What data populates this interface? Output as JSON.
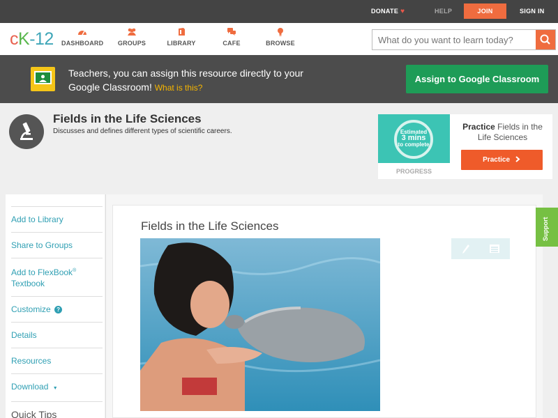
{
  "topbar": {
    "donate": "DONATE",
    "help": "HELP",
    "join": "JOIN",
    "signin": "SIGN IN"
  },
  "brand": {
    "c": "c",
    "k": "K",
    "n": "-12"
  },
  "nav": {
    "dashboard": "DASHBOARD",
    "groups": "GROUPS",
    "library": "LIBRARY",
    "cafe": "CAFE",
    "browse": "BROWSE"
  },
  "search": {
    "placeholder": "What do you want to learn today?"
  },
  "banner": {
    "text": "Teachers, you can assign this resource directly to your Google Classroom!",
    "link": "What is this?",
    "button": "Assign to Google Classroom"
  },
  "concept": {
    "title": "Fields in the Life Sciences",
    "description": "Discusses and defines different types of scientific careers."
  },
  "practice": {
    "estimated": "Estimated",
    "mins": "3 mins",
    "complete": "to complete",
    "progress_label": "PROGRESS",
    "title_bold": "Practice",
    "title_rest": "Fields in the Life Sciences",
    "button": "Practice"
  },
  "sidebar": {
    "items": [
      {
        "label": "Add to Library"
      },
      {
        "label": "Share to Groups"
      },
      {
        "label": "Add to FlexBook",
        "sup": "®",
        "line2": "Textbook"
      },
      {
        "label": "Customize"
      },
      {
        "label": "Details"
      },
      {
        "label": "Resources"
      },
      {
        "label": "Download"
      }
    ],
    "quick_tips": "Quick Tips",
    "help_mark": "?",
    "download_caret": "▼"
  },
  "content": {
    "title": "Fields in the Life Sciences"
  },
  "support": "Support",
  "colors": {
    "accent": "#ef6c3f",
    "link": "#2f9fb3",
    "classroom_green": "#1e9c57",
    "support_green": "#76c043"
  }
}
